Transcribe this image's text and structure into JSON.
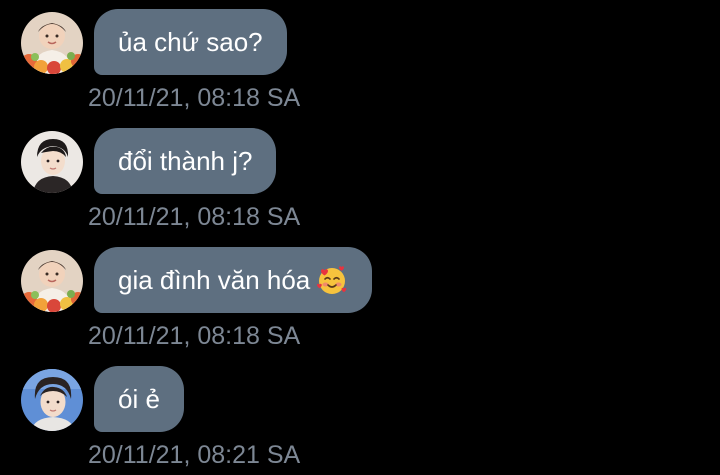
{
  "messages": [
    {
      "avatar": "avatar-flower-headband",
      "text": "ủa chứ sao?",
      "emoji": null,
      "timestamp": "20/11/21, 08:18 SA"
    },
    {
      "avatar": "avatar-dark-hair-male",
      "text": "đổi thành j?",
      "emoji": null,
      "timestamp": "20/11/21, 08:18 SA"
    },
    {
      "avatar": "avatar-flower-headband",
      "text": "gia đình văn hóa",
      "emoji": "smiling-face-with-hearts",
      "timestamp": "20/11/21, 08:18 SA"
    },
    {
      "avatar": "avatar-blue-background-male",
      "text": "ói ẻ",
      "emoji": null,
      "timestamp": "20/11/21, 08:21 SA"
    }
  ],
  "colors": {
    "background": "#000000",
    "bubble": "#5e6f80",
    "message_text": "#ffffff",
    "timestamp": "#7d8794"
  }
}
